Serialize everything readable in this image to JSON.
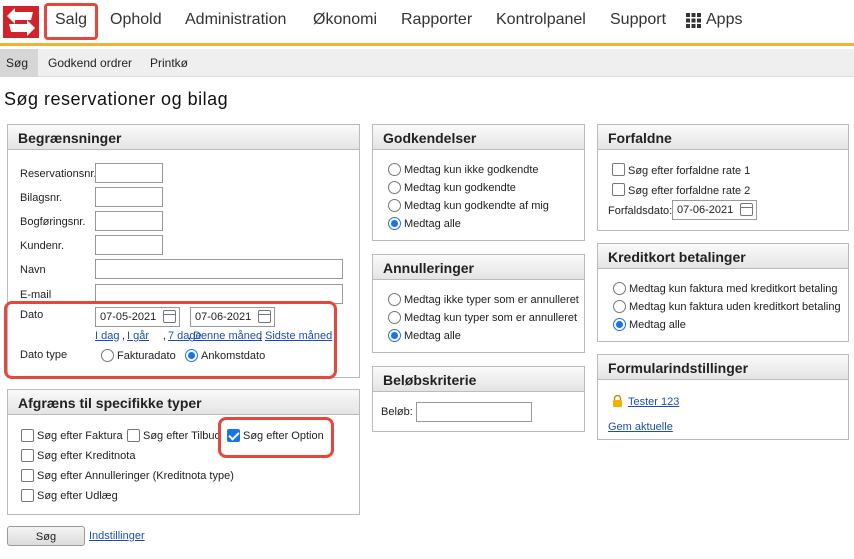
{
  "nav": {
    "items": [
      "Salg",
      "Ophold",
      "Administration",
      "Økonomi",
      "Rapporter",
      "Kontrolpanel",
      "Support",
      "Apps"
    ],
    "selected": "Salg"
  },
  "subnav": {
    "items": [
      "Søg",
      "Godkend ordrer",
      "Printkø"
    ],
    "active": "Søg"
  },
  "page_title": "Søg reservationer og bilag",
  "begraensninger": {
    "title": "Begrænsninger",
    "fields": [
      "Reservationsnr.",
      "Bilagsnr.",
      "Bogføringsnr.",
      "Kundenr.",
      "Navn",
      "E-mail"
    ],
    "dato_label": "Dato",
    "date_from": "07-05-2021",
    "date_to": "07-06-2021",
    "quick_links": [
      "I dag",
      "I går",
      "7 dage",
      "Denne måned",
      "Sidste måned"
    ],
    "datotype_label": "Dato type",
    "datotype_options": [
      "Fakturadato",
      "Ankomstdato"
    ],
    "datotype_selected": "Ankomstdato"
  },
  "typer": {
    "title": "Afgræns til specifikke typer",
    "options": [
      "Søg efter Faktura",
      "Søg efter Tilbud",
      "Søg efter Option",
      "Søg efter Kreditnota",
      "Søg efter Annulleringer (Kreditnota type)",
      "Søg efter Udlæg"
    ],
    "checked": "Søg efter Option"
  },
  "godkendelser": {
    "title": "Godkendelser",
    "options": [
      "Medtag kun ikke godkendte",
      "Medtag kun godkendte",
      "Medtag kun godkendte af mig",
      "Medtag alle"
    ],
    "selected": "Medtag alle"
  },
  "annulleringer": {
    "title": "Annulleringer",
    "options": [
      "Medtag ikke typer som er annulleret",
      "Medtag kun typer som er annulleret",
      "Medtag alle"
    ],
    "selected": "Medtag alle"
  },
  "beloeb": {
    "title": "Beløbskriterie",
    "label": "Beløb:"
  },
  "forfaldne": {
    "title": "Forfaldne",
    "options": [
      "Søg efter forfaldne rate 1",
      "Søg efter forfaldne rate 2"
    ],
    "date_label": "Forfaldsdato:",
    "date": "07-06-2021"
  },
  "kreditkort": {
    "title": "Kreditkort betalinger",
    "options": [
      "Medtag kun faktura med kreditkort betaling",
      "Medtag kun faktura uden kreditkort betaling",
      "Medtag alle"
    ],
    "selected": "Medtag alle"
  },
  "formular": {
    "title": "Formularindstillinger",
    "saved": "Tester 123",
    "save_current": "Gem aktuelle"
  },
  "footer": {
    "search_button": "Søg",
    "settings_link": "Indstillinger"
  },
  "colors": {
    "accent": "#f6b135",
    "highlight": "#e4473c",
    "link": "#1a4fb5",
    "brand": "#d2232a"
  }
}
